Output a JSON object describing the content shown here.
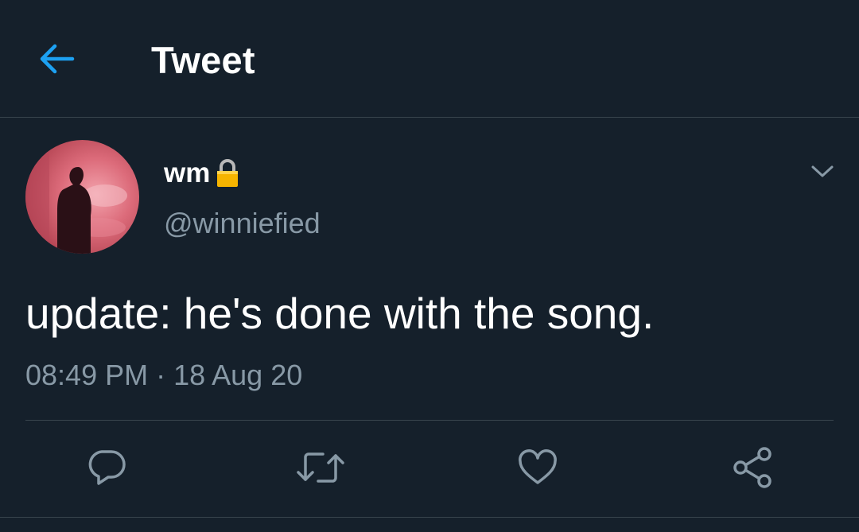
{
  "header": {
    "title": "Tweet",
    "back_icon": "arrow-left-icon",
    "accent_color": "#1da1f2"
  },
  "tweet": {
    "display_name": "wm",
    "protected_icon": "lock-icon",
    "handle": "@winniefied",
    "text": "update: he's done with the song.",
    "timestamp": "08:49 PM · 18 Aug 20",
    "menu_icon": "chevron-down-icon"
  },
  "actions": [
    {
      "name": "reply",
      "icon": "reply-icon"
    },
    {
      "name": "retweet",
      "icon": "retweet-icon"
    },
    {
      "name": "like",
      "icon": "heart-icon"
    },
    {
      "name": "share",
      "icon": "share-icon"
    }
  ],
  "colors": {
    "background": "#15202b",
    "secondary_text": "#8899a6",
    "divider": "#38444d",
    "accent": "#1da1f2"
  }
}
